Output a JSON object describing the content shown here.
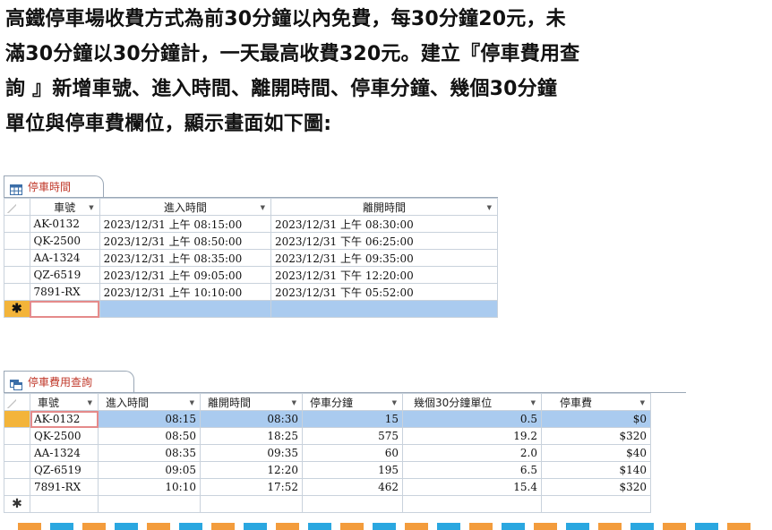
{
  "intro": {
    "line1": "高鐵停車場收費方式為前30分鐘以內免費，每30分鐘20元，未",
    "line2": "滿30分鐘以30分鐘計，一天最高收費320元。建立『停車費用查",
    "line3": "詢 』新增車號、進入時間、離開時間、停車分鐘、幾個30分鐘",
    "line4": "單位與停車費欄位，顯示畫面如下圖:"
  },
  "table1": {
    "tab_label": "停車時間",
    "tab_icon": "table-icon",
    "headers": [
      "車號",
      "進入時間",
      "離開時間"
    ],
    "rows": [
      [
        "AK-0132",
        "2023/12/31 上午 08:15:00",
        "2023/12/31 上午 08:30:00"
      ],
      [
        "QK-2500",
        "2023/12/31 上午 08:50:00",
        "2023/12/31 下午 06:25:00"
      ],
      [
        "AA-1324",
        "2023/12/31 上午 08:35:00",
        "2023/12/31 上午 09:35:00"
      ],
      [
        "QZ-6519",
        "2023/12/31 上午 09:05:00",
        "2023/12/31 下午 12:20:00"
      ],
      [
        "7891-RX",
        "2023/12/31 上午 10:10:00",
        "2023/12/31 下午 05:52:00"
      ]
    ],
    "new_row_marker": "✱"
  },
  "table2": {
    "tab_label": "停車費用查詢",
    "tab_icon": "query-icon",
    "headers": [
      "車號",
      "進入時間",
      "離開時間",
      "停車分鐘",
      "幾個30分鐘單位",
      "停車費"
    ],
    "rows": [
      [
        "AK-0132",
        "08:15",
        "08:30",
        "15",
        "0.5",
        "$0"
      ],
      [
        "QK-2500",
        "08:50",
        "18:25",
        "575",
        "19.2",
        "$320"
      ],
      [
        "AA-1324",
        "08:35",
        "09:35",
        "60",
        "2.0",
        "$40"
      ],
      [
        "QZ-6519",
        "09:05",
        "12:20",
        "195",
        "6.5",
        "$140"
      ],
      [
        "7891-RX",
        "10:10",
        "17:52",
        "462",
        "15.4",
        "$320"
      ]
    ],
    "new_row_marker": "✱"
  },
  "colors": {
    "selected_row": "#aacbef",
    "record_selector": "#f3b43a",
    "tab_text": "#c0392b",
    "deco_orange": "#f39c3c",
    "deco_blue": "#2aa7e0"
  }
}
